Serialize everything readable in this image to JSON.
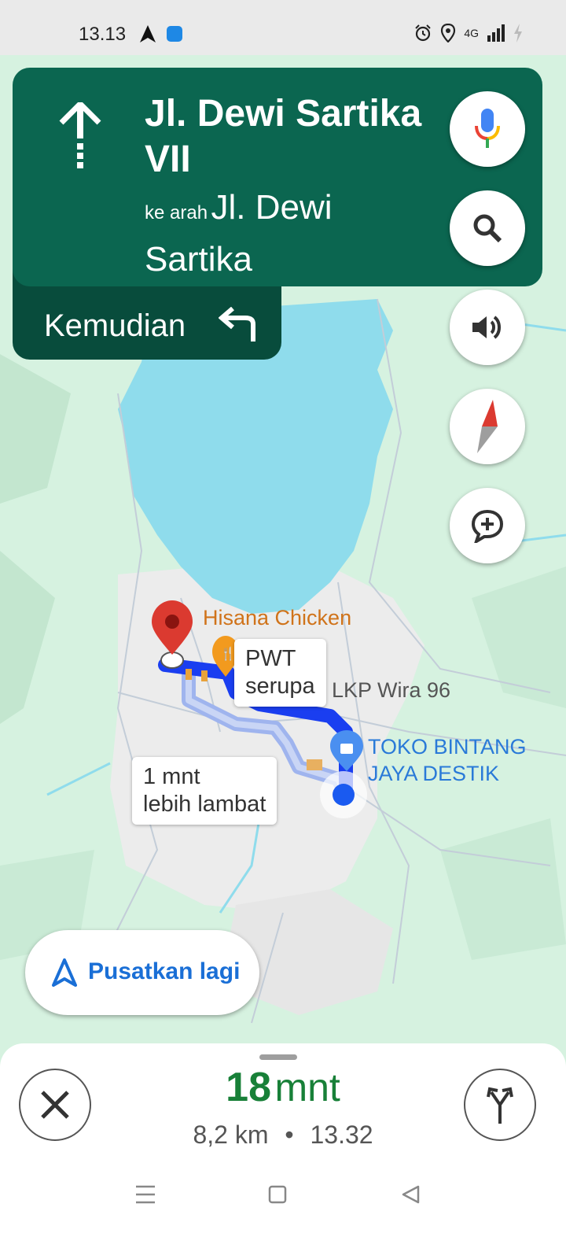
{
  "status_bar": {
    "time": "13.13",
    "network": "4G",
    "icons": [
      "navigation-arrow-icon",
      "app-badge-icon",
      "alarm-icon",
      "location-icon",
      "signal-icon",
      "battery-charging-icon"
    ]
  },
  "navigation": {
    "direction_icon": "straight-arrow-icon",
    "street": "Jl. Dewi Sartika VII",
    "toward_prefix": "ke arah",
    "toward_street": "Jl. Dewi Sartika",
    "then_label": "Kemudian",
    "then_icon": "turn-left-icon"
  },
  "map_buttons": [
    "microphone-icon",
    "search-icon",
    "volume-icon",
    "compass-icon",
    "add-report-icon"
  ],
  "map": {
    "places": {
      "restaurant": "Hisana Chicken",
      "store_line1": "TOKO BINTANG",
      "store_line2": "JAYA DESTIK",
      "place": "LKP Wira 96"
    },
    "callout_alt_route": {
      "line1": "PWT",
      "line2": "serupa"
    },
    "callout_slower": {
      "line1": "1 mnt",
      "line2": "lebih lambat"
    },
    "colors": {
      "route": "#1a3ef0",
      "alt_route": "#9fb4ee",
      "water": "#8fdcec",
      "land": "#d6f2e0",
      "destination_pin": "#db3a30"
    }
  },
  "recenter": {
    "label": "Pusatkan lagi"
  },
  "trip": {
    "eta_value": "18",
    "eta_unit": "mnt",
    "distance": "8,2 km",
    "separator": "•",
    "arrival_time": "13.32"
  },
  "bottom_buttons": [
    "close-icon",
    "alternate-routes-icon"
  ],
  "system_nav": [
    "menu-icon",
    "home-icon",
    "back-icon"
  ]
}
